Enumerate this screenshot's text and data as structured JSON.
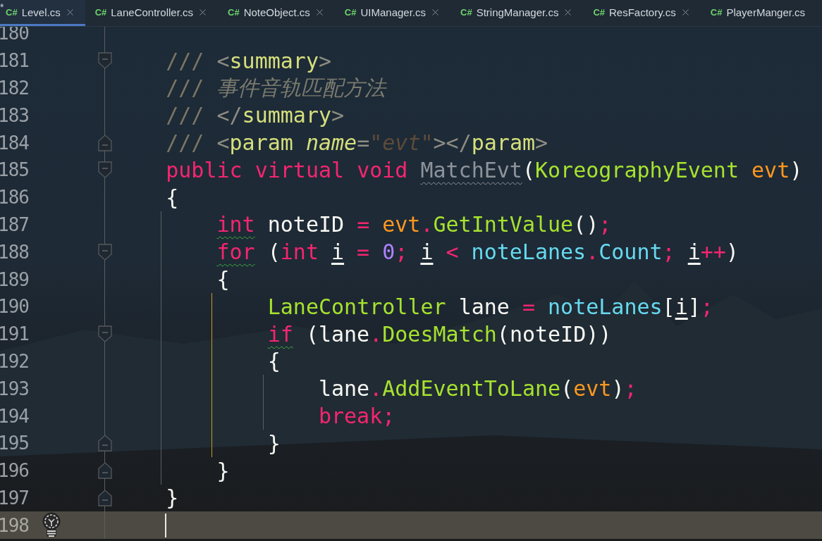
{
  "tabs": [
    {
      "prefix": "*",
      "lang": "C#",
      "label": "Level.cs",
      "selected": true,
      "closable": true
    },
    {
      "lang": "C#",
      "label": "LaneController.cs",
      "selected": false,
      "closable": true
    },
    {
      "lang": "C#",
      "label": "NoteObject.cs",
      "selected": false,
      "closable": true
    },
    {
      "lang": "C#",
      "label": "UIManager.cs",
      "selected": false,
      "closable": true
    },
    {
      "lang": "C#",
      "label": "StringManager.cs",
      "selected": false,
      "closable": true
    },
    {
      "lang": "C#",
      "label": "ResFactory.cs",
      "selected": false,
      "closable": true
    },
    {
      "lang": "C#",
      "label": "PlayerManger.cs",
      "selected": false,
      "closable": false
    }
  ],
  "lines": [
    {
      "number": "180"
    },
    {
      "number": "181",
      "kind": "fold_start",
      "tokens": [
        {
          "kind": "comment",
          "t": "///"
        },
        {
          "kind": "tagp",
          "t": "<",
          "gap": true
        },
        {
          "kind": "tag",
          "t": "summary"
        },
        {
          "kind": "tagp",
          "t": ">"
        }
      ]
    },
    {
      "number": "182",
      "tokens": [
        {
          "kind": "comment",
          "t": "///"
        },
        {
          "kind": "ctext",
          "t": "事件音轨匹配方法",
          "gap": true
        }
      ]
    },
    {
      "number": "183",
      "tokens": [
        {
          "kind": "comment",
          "t": "///"
        },
        {
          "kind": "tagp",
          "t": "</",
          "gap": true
        },
        {
          "kind": "tag",
          "t": "summary"
        },
        {
          "kind": "tagp",
          "t": ">"
        }
      ]
    },
    {
      "number": "184",
      "kind": "fold_end",
      "tokens": [
        {
          "kind": "comment",
          "t": "///"
        },
        {
          "kind": "tagp",
          "t": "<",
          "gap": true
        },
        {
          "kind": "tag",
          "t": "param"
        },
        {
          "kind": "attr",
          "t": "name",
          "gap": true
        },
        {
          "kind": "tagp",
          "t": "="
        },
        {
          "kind": "string",
          "t": "\"evt\""
        },
        {
          "kind": "tagp",
          "t": "></"
        },
        {
          "kind": "tag",
          "t": "param"
        },
        {
          "kind": "tagp",
          "t": ">"
        }
      ]
    },
    {
      "number": "185",
      "kind": "fold_start",
      "tokens": [
        {
          "kind": "kw",
          "t": "public"
        },
        {
          "kind": "kw",
          "t": "virtual",
          "gap": true
        },
        {
          "kind": "kw",
          "t": "void",
          "gap": true
        },
        {
          "kind": "decl",
          "t": "MatchEvt",
          "gap": true,
          "warn": true
        },
        {
          "kind": "punct",
          "t": "("
        },
        {
          "kind": "type",
          "t": "KoreographyEvent"
        },
        {
          "kind": "param",
          "t": "evt",
          "gap": true
        },
        {
          "kind": "punct",
          "t": ")"
        }
      ]
    },
    {
      "number": "186",
      "tokens": [
        {
          "kind": "lbrace",
          "t": "{"
        }
      ]
    },
    {
      "number": "187",
      "tokens": [
        {
          "kind": "kw",
          "t": "int",
          "typo": true
        },
        {
          "kind": "ident",
          "t": "noteID",
          "gap": true
        },
        {
          "kind": "op",
          "t": "=",
          "gap": true
        },
        {
          "kind": "param",
          "t": "evt",
          "gap": true
        },
        {
          "kind": "op",
          "t": "."
        },
        {
          "kind": "type",
          "t": "GetIntValue"
        },
        {
          "kind": "punct",
          "t": "()"
        },
        {
          "kind": "op",
          "t": ";"
        }
      ]
    },
    {
      "number": "188",
      "kind": "fold_start",
      "tokens": [
        {
          "kind": "kw",
          "t": "for",
          "typo": true
        },
        {
          "kind": "punct",
          "t": "(",
          "gap": true
        },
        {
          "kind": "kw",
          "t": "int"
        },
        {
          "kind": "ident",
          "t": "i",
          "gap": true,
          "underlined": true
        },
        {
          "kind": "op",
          "t": "=",
          "gap": true
        },
        {
          "kind": "num",
          "t": "0",
          "gap": true
        },
        {
          "kind": "op",
          "t": ";"
        },
        {
          "kind": "ident",
          "t": "i",
          "gap": true,
          "underlined": true
        },
        {
          "kind": "op",
          "t": "<",
          "gap": true
        },
        {
          "kind": "field",
          "t": "noteLanes",
          "gap": true
        },
        {
          "kind": "op",
          "t": "."
        },
        {
          "kind": "field",
          "t": "Count"
        },
        {
          "kind": "op",
          "t": ";"
        },
        {
          "kind": "ident",
          "t": "i",
          "gap": true,
          "underlined": true
        },
        {
          "kind": "op",
          "t": "++"
        },
        {
          "kind": "punct",
          "t": ")"
        }
      ]
    },
    {
      "number": "189",
      "tokens": [
        {
          "kind": "lbrace",
          "t": "{"
        }
      ]
    },
    {
      "number": "190",
      "tokens": [
        {
          "kind": "type",
          "t": "LaneController"
        },
        {
          "kind": "ident",
          "t": "lane",
          "gap": true
        },
        {
          "kind": "op",
          "t": "=",
          "gap": true
        },
        {
          "kind": "field",
          "t": "noteLanes",
          "gap": true
        },
        {
          "kind": "punct",
          "t": "["
        },
        {
          "kind": "ident",
          "t": "i",
          "underlined": true
        },
        {
          "kind": "punct",
          "t": "]"
        },
        {
          "kind": "op",
          "t": ";"
        }
      ]
    },
    {
      "number": "191",
      "kind": "fold_start",
      "tokens": [
        {
          "kind": "kw",
          "t": "if",
          "typo": true
        },
        {
          "kind": "punct",
          "t": "(",
          "gap": true
        },
        {
          "kind": "ident",
          "t": "lane"
        },
        {
          "kind": "op",
          "t": "."
        },
        {
          "kind": "type",
          "t": "DoesMatch"
        },
        {
          "kind": "punct",
          "t": "("
        },
        {
          "kind": "ident",
          "t": "noteID"
        },
        {
          "kind": "punct",
          "t": "))"
        }
      ]
    },
    {
      "number": "192",
      "tokens": [
        {
          "kind": "lbrace",
          "t": "{"
        }
      ]
    },
    {
      "number": "193",
      "tokens": [
        {
          "kind": "ident",
          "t": "lane"
        },
        {
          "kind": "op",
          "t": "."
        },
        {
          "kind": "type",
          "t": "AddEventToLane"
        },
        {
          "kind": "punct",
          "t": "("
        },
        {
          "kind": "param",
          "t": "evt"
        },
        {
          "kind": "punct",
          "t": ")"
        },
        {
          "kind": "op",
          "t": ";"
        }
      ]
    },
    {
      "number": "194",
      "tokens": [
        {
          "kind": "kw",
          "t": "break"
        },
        {
          "kind": "op",
          "t": ";"
        }
      ]
    },
    {
      "number": "195",
      "kind": "fold_end",
      "tokens": [
        {
          "kind": "rbrace",
          "t": "}"
        }
      ]
    },
    {
      "number": "196",
      "kind": "fold_end",
      "tokens": [
        {
          "kind": "rbrace",
          "t": "}"
        }
      ]
    },
    {
      "number": "197",
      "kind": "fold_end",
      "tokens": [
        {
          "kind": "rbrace",
          "t": "}"
        }
      ]
    },
    {
      "number": "198",
      "current": true,
      "hint": true
    }
  ]
}
